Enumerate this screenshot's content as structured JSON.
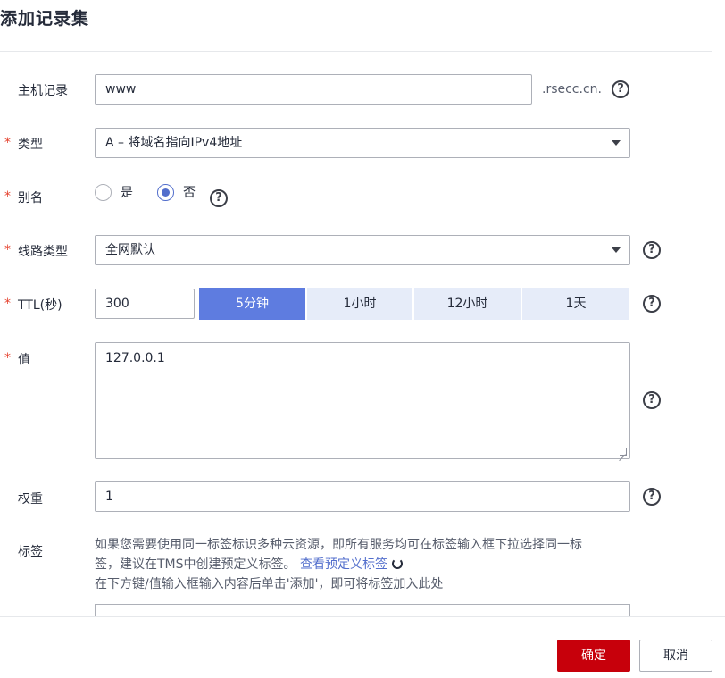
{
  "dialog": {
    "title": "添加记录集"
  },
  "required_mark": "*",
  "help_glyph": "?",
  "form": {
    "host": {
      "label": "主机记录",
      "value": "www",
      "suffix": ".rsecc.cn."
    },
    "type": {
      "label": "类型",
      "value": "A – 将域名指向IPv4地址"
    },
    "alias": {
      "label": "别名",
      "options": [
        "是",
        "否"
      ],
      "selected": "否"
    },
    "line": {
      "label": "线路类型",
      "value": "全网默认"
    },
    "ttl": {
      "label": "TTL(秒)",
      "value": "300",
      "presets": [
        "5分钟",
        "1小时",
        "12小时",
        "1天"
      ],
      "active_preset": "5分钟"
    },
    "value": {
      "label": "值",
      "text": "127.0.0.1"
    },
    "weight": {
      "label": "权重",
      "value": "1"
    },
    "tags": {
      "label": "标签",
      "info_line1": "如果您需要使用同一标签标识多种云资源，即所有服务均可在标签输入框下拉选择同一标",
      "info_line2": "签，建议在TMS中创建预定义标签。",
      "link": "查看预定义标签",
      "info_line3": "在下方键/值输入框输入内容后单击'添加'，即可将标签加入此处"
    }
  },
  "footer": {
    "ok_label": "确定",
    "cancel_label": "取消"
  },
  "colors": {
    "primary": "#5e7ce0",
    "danger": "#c7000b",
    "required": "#e5402c",
    "link": "#526ecc"
  }
}
